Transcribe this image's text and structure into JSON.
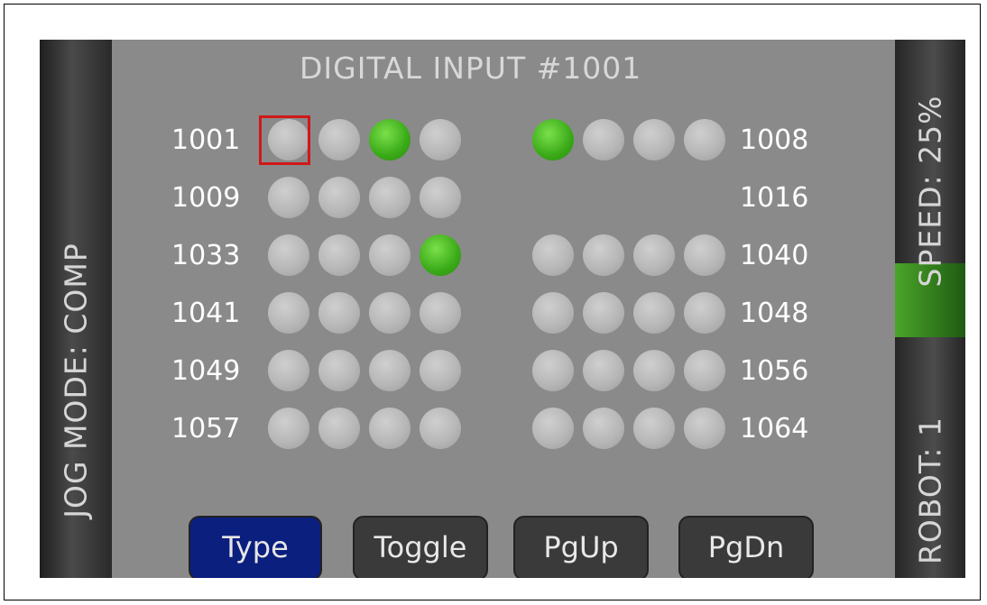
{
  "title": "DIGITAL INPUT #1001",
  "sidebar_left": {
    "jog_mode": "JOG MODE: COMP"
  },
  "sidebar_right": {
    "speed": "SPEED: 25%",
    "robot": "ROBOT: 1"
  },
  "rows": [
    {
      "left_label": "1001",
      "right_label": "1008",
      "left_states": [
        false,
        false,
        true,
        false
      ],
      "right_states": [
        true,
        false,
        false,
        false
      ],
      "right_visible": true
    },
    {
      "left_label": "1009",
      "right_label": "1016",
      "left_states": [
        false,
        false,
        false,
        false
      ],
      "right_states": [],
      "right_visible": false
    },
    {
      "left_label": "1033",
      "right_label": "1040",
      "left_states": [
        false,
        false,
        false,
        true
      ],
      "right_states": [
        false,
        false,
        false,
        false
      ],
      "right_visible": true
    },
    {
      "left_label": "1041",
      "right_label": "1048",
      "left_states": [
        false,
        false,
        false,
        false
      ],
      "right_states": [
        false,
        false,
        false,
        false
      ],
      "right_visible": true
    },
    {
      "left_label": "1049",
      "right_label": "1056",
      "left_states": [
        false,
        false,
        false,
        false
      ],
      "right_states": [
        false,
        false,
        false,
        false
      ],
      "right_visible": true
    },
    {
      "left_label": "1057",
      "right_label": "1064",
      "left_states": [
        false,
        false,
        false,
        false
      ],
      "right_states": [
        false,
        false,
        false,
        false
      ],
      "right_visible": true
    }
  ],
  "buttons": {
    "type": "Type",
    "toggle": "Toggle",
    "pgup": "PgUp",
    "pgdn": "PgDn"
  },
  "colors": {
    "led_on": "#3aaa18",
    "led_off": "#b7b7b7",
    "cursor": "#d0181a",
    "type_button": "#0b1f7e"
  }
}
